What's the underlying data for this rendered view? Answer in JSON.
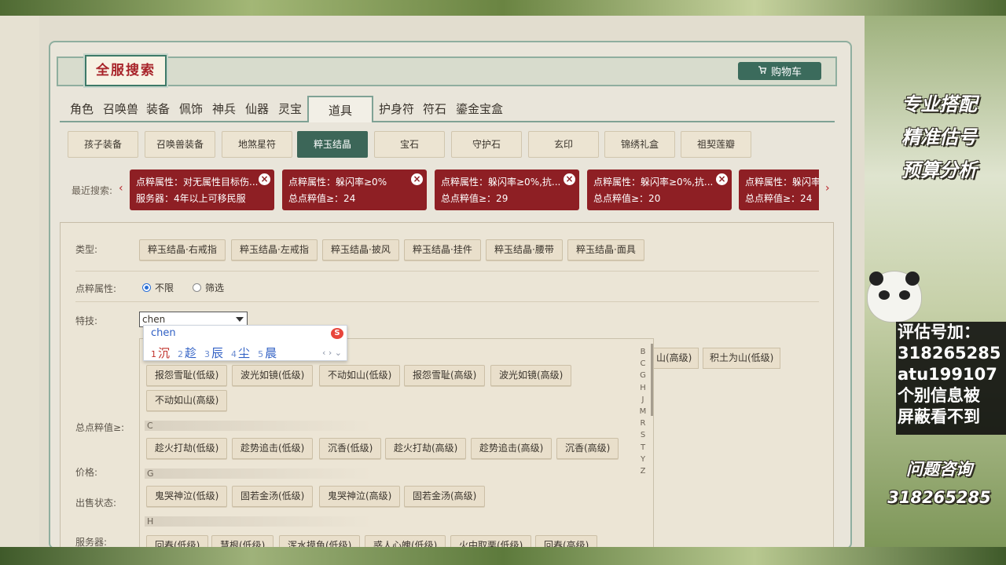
{
  "header": {
    "title": "全服搜索",
    "cart_label": "购物车"
  },
  "tabs": [
    {
      "label": "角色"
    },
    {
      "label": "召唤兽"
    },
    {
      "label": "装备"
    },
    {
      "label": "佩饰"
    },
    {
      "label": "神兵"
    },
    {
      "label": "仙器"
    },
    {
      "label": "灵宝"
    },
    {
      "label": "道具",
      "active": true
    },
    {
      "label": "护身符"
    },
    {
      "label": "符石"
    },
    {
      "label": "鎏金宝盒"
    }
  ],
  "subtabs": [
    {
      "label": "孩子装备"
    },
    {
      "label": "召唤兽装备"
    },
    {
      "label": "地煞星符"
    },
    {
      "label": "粹玉结晶",
      "active": true
    },
    {
      "label": "宝石"
    },
    {
      "label": "守护石"
    },
    {
      "label": "玄印"
    },
    {
      "label": "锦绣礼盒"
    },
    {
      "label": "祖契莲瓣"
    }
  ],
  "recent": {
    "label": "最近搜索:",
    "chips": [
      {
        "line1": "点粹属性：对无属性目标伤...",
        "line2": "服务器：4年以上可移民服"
      },
      {
        "line1": "点粹属性：躲闪率≥0%",
        "line2": "总点粹值≥：24"
      },
      {
        "line1": "点粹属性：躲闪率≥0%,抗...",
        "line2": "总点粹值≥：29"
      },
      {
        "line1": "点粹属性：躲闪率≥0%,抗...",
        "line2": "总点粹值≥：20"
      },
      {
        "line1": "点粹属性：躲闪率",
        "line2": "总点粹值≥：24"
      }
    ]
  },
  "form": {
    "type_label": "类型:",
    "types": [
      "粹玉结晶·右戒指",
      "粹玉结晶·左戒指",
      "粹玉结晶·披风",
      "粹玉结晶·挂件",
      "粹玉结晶·腰带",
      "粹玉结晶·面具"
    ],
    "attr_label": "点粹属性:",
    "radio_all": "不限",
    "radio_filter": "筛选",
    "skill_label": "特技:",
    "skill_input": "chen",
    "total_label": "总点粹值≥:",
    "price_label": "价格:",
    "status_label": "出售状态:",
    "server_label": "服务器:",
    "right_buttons": [
      "山(高级)",
      "积土为山(低级)"
    ]
  },
  "ime": {
    "input": "chen",
    "candidates": [
      {
        "n": "1",
        "t": "沉"
      },
      {
        "n": "2",
        "t": "趁"
      },
      {
        "n": "3",
        "t": "辰"
      },
      {
        "n": "4",
        "t": "尘"
      },
      {
        "n": "5",
        "t": "晨"
      }
    ],
    "nav": "‹ › ⌄"
  },
  "dropdown": {
    "rows_b": [
      "报怨雪耻(低级)",
      "波光如镜(低级)",
      "不动如山(低级)",
      "报怨雪耻(高级)",
      "波光如镜(高级)"
    ],
    "rows_b2": [
      "不动如山(高级)"
    ],
    "group_c": "C",
    "rows_c": [
      "趁火打劫(低级)",
      "趁势追击(低级)",
      "沉香(低级)",
      "趁火打劫(高级)",
      "趁势追击(高级)",
      "沉香(高级)"
    ],
    "group_g": "G",
    "rows_g": [
      "鬼哭神泣(低级)",
      "固若金汤(低级)",
      "鬼哭神泣(高级)",
      "固若金汤(高级)"
    ],
    "group_h": "H",
    "rows_h": [
      "回春(低级)",
      "慧根(低级)",
      "浑水摸鱼(低级)",
      "惑人心魄(低级)",
      "火中取栗(低级)",
      "回春(高级)"
    ],
    "letters": [
      "B",
      "C",
      "G",
      "H",
      "J",
      "M",
      "R",
      "S",
      "T",
      "Y",
      "Z"
    ]
  },
  "ads": {
    "line1": "专业搭配",
    "line2": "精准估号",
    "line3": "预算分析",
    "contact": [
      "评估号加：",
      "318265285",
      "atu199107",
      "个别信息被",
      "屏蔽看不到"
    ],
    "ask": "问题咨询",
    "ask_num": "318265285"
  }
}
